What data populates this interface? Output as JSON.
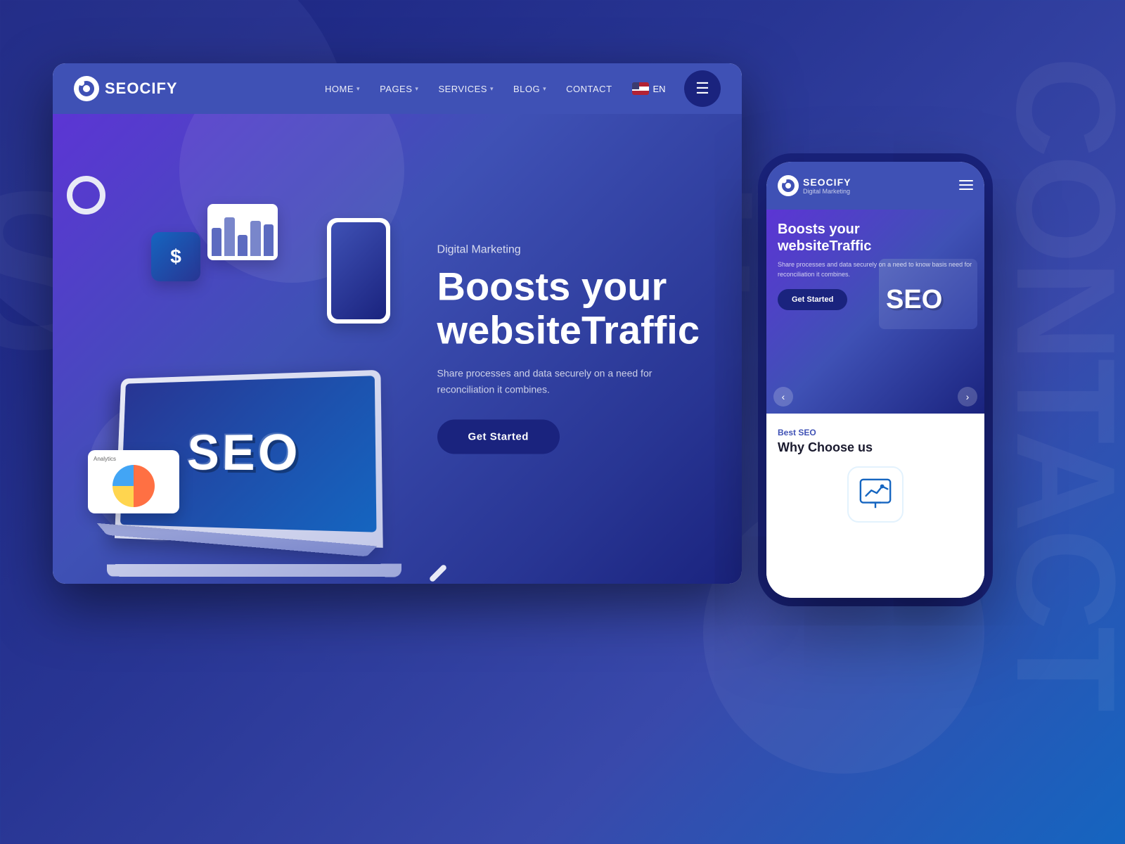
{
  "background": {
    "color_start": "#1a237e",
    "color_end": "#1565c0"
  },
  "bg_text": "SEOCIFY",
  "bg_text_contact": "CONTACT",
  "desktop": {
    "nav": {
      "logo": "SEOCIFY",
      "links": [
        {
          "label": "HOME",
          "has_dropdown": true
        },
        {
          "label": "PAGES",
          "has_dropdown": true
        },
        {
          "label": "SERVICES",
          "has_dropdown": true
        },
        {
          "label": "BLOG",
          "has_dropdown": true
        },
        {
          "label": "CONTACT",
          "has_dropdown": false
        }
      ],
      "language": "EN",
      "menu_icon": "≡"
    },
    "hero": {
      "subtitle": "Digital Marketing",
      "title_line1": "Boosts your",
      "title_line2": "websiteTraffic",
      "description": "Share processes and data securely on a need for reconciliation it combines.",
      "cta_label": "Get Started"
    }
  },
  "mobile": {
    "nav": {
      "logo": "SEOCIFY",
      "subtitle": "Digital Marketing",
      "menu_icon": "≡"
    },
    "hero": {
      "title_line1": "Boosts your",
      "title_line2": "websiteTraffic",
      "description": "Share processes and data securely on a need to know basis need for reconciliation it combines.",
      "cta_label": "Get Started",
      "prev_arrow": "‹",
      "next_arrow": "›",
      "seo_text": "SEO"
    },
    "why_section": {
      "label": "Best SEO",
      "title": "Why Choose us"
    }
  }
}
